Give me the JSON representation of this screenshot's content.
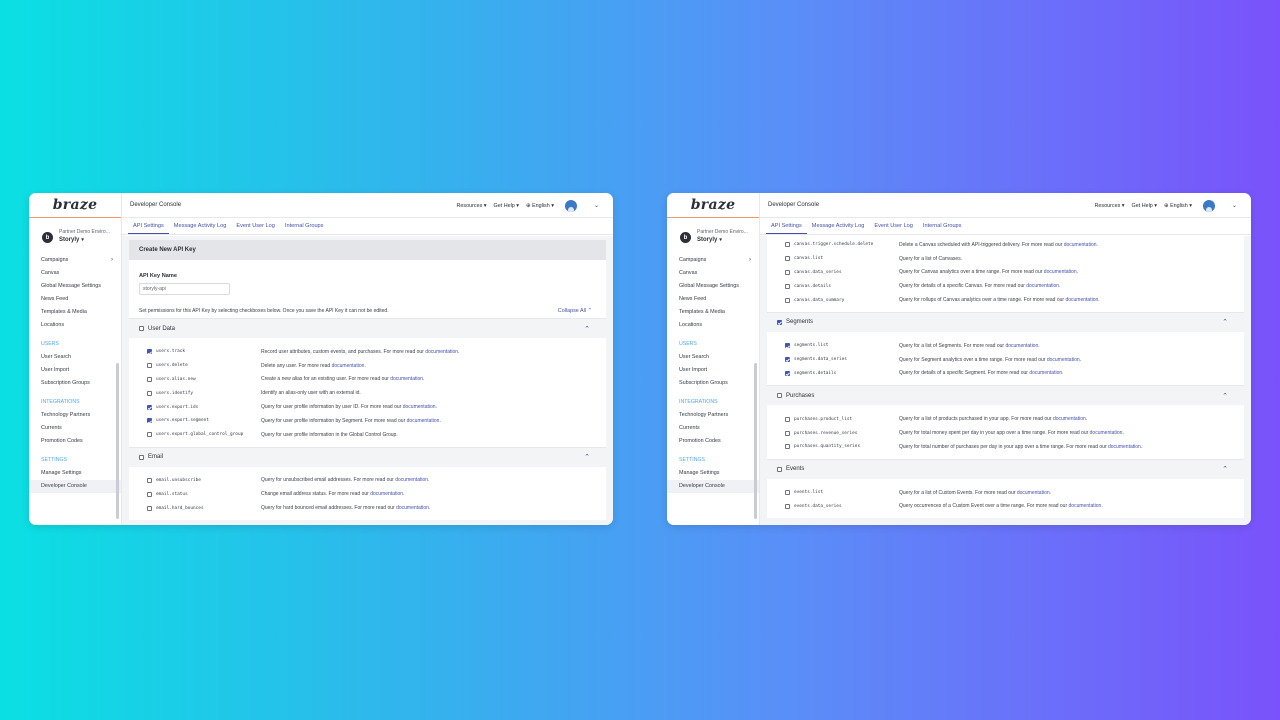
{
  "app": {
    "logo": "braze",
    "workspace_env": "Partner Demo Enviro...",
    "workspace_name": "Storyly",
    "topbar_title": "Developer Console",
    "resources": "Resources",
    "get_help": "Get Help",
    "language": "English"
  },
  "sidebar": {
    "items_top": [
      {
        "label": "Campaigns",
        "arrow": "›"
      },
      {
        "label": "Canvas"
      },
      {
        "label": "Global Message Settings"
      },
      {
        "label": "News Feed"
      },
      {
        "label": "Templates & Media"
      },
      {
        "label": "Locations"
      }
    ],
    "users_head": "USERS",
    "users_items": [
      "User Search",
      "User Import",
      "Subscription Groups"
    ],
    "integrations_head": "INTEGRATIONS",
    "integrations_items": [
      "Technology Partners",
      "Currents",
      "Promotion Codes"
    ],
    "settings_head": "SETTINGS",
    "settings_items": [
      "Manage Settings",
      "Developer Console"
    ]
  },
  "tabs": [
    "API Settings",
    "Message Activity Log",
    "Event User Log",
    "Internal Groups"
  ],
  "left": {
    "card_title": "Create New API Key",
    "key_name_label": "API Key Name",
    "key_name_value": "storyly-api",
    "help_text": "Set permissions for this API Key by selecting checkboxes below. Once you save the API Key it can not be edited.",
    "collapse_all": "Collapse All",
    "sections": [
      {
        "title": "User Data",
        "rows": [
          {
            "name": "users.track",
            "desc": "Record user attributes, custom events, and purchases. For more read our ",
            "checked": true
          },
          {
            "name": "users.delete",
            "desc": "Delete any user. For more read ",
            "checked": false
          },
          {
            "name": "users.alias.new",
            "desc": "Create a new alias for an existing user. For more read our ",
            "checked": false
          },
          {
            "name": "users.identify",
            "desc": "Identify an alias-only user with an external id.",
            "checked": false,
            "nolink": true
          },
          {
            "name": "users.export.ids",
            "desc": "Query for user profile information by user ID. For more read our ",
            "checked": true
          },
          {
            "name": "users.export.segment",
            "desc": "Query for user profile information by Segment. For more read our ",
            "checked": true
          },
          {
            "name": "users.export.global_control_group",
            "desc": "Query for user profile information in the Global Control Group.",
            "checked": false,
            "nolink": true
          }
        ]
      },
      {
        "title": "Email",
        "rows": [
          {
            "name": "email.unsubscribe",
            "desc": "Query for unsubscribed email addresses. For more read our ",
            "checked": false
          },
          {
            "name": "email.status",
            "desc": "Change email address status. For more read our ",
            "checked": false
          },
          {
            "name": "email.hard_bounces",
            "desc": "Query for hard bounced email addresses. For more read our ",
            "checked": false
          }
        ]
      }
    ]
  },
  "right": {
    "canvas_rows": [
      {
        "name": "canvas.trigger.schedule.delete",
        "desc": "Delete a Canvas scheduled with API-triggered delivery. For more read our ",
        "checked": false
      },
      {
        "name": "canvas.list",
        "desc": "Query for a list of Canvases.",
        "checked": false,
        "nolink": true
      },
      {
        "name": "canvas.data_series",
        "desc": "Query for Canvas analytics over a time range. For more read our ",
        "checked": false
      },
      {
        "name": "canvas.details",
        "desc": "Query for details of a specific Canvas. For more read our ",
        "checked": false
      },
      {
        "name": "canvas.data_summary",
        "desc": "Query for rollups of Canvas analytics over a time range. For more read our ",
        "checked": false
      }
    ],
    "sections": [
      {
        "title": "Segments",
        "checked": true,
        "rows": [
          {
            "name": "segments.list",
            "desc": "Query for a list of Segments. For more read our ",
            "checked": true
          },
          {
            "name": "segments.data_series",
            "desc": "Query for Segment analytics over a time range. For more read our ",
            "checked": true
          },
          {
            "name": "segments.details",
            "desc": "Query for details of a specific Segment. For more read our ",
            "checked": true
          }
        ]
      },
      {
        "title": "Purchases",
        "checked": false,
        "rows": [
          {
            "name": "purchases.product_list",
            "desc": "Query for a list of products purchased in your app. For more read our ",
            "checked": false
          },
          {
            "name": "purchases.revenue_series",
            "desc": "Query for total money spent per day in your app over a time range. For more read our ",
            "checked": false
          },
          {
            "name": "purchases.quantity_series",
            "desc": "Query for total number of purchases per day in your app over a time range. For more read our ",
            "checked": false
          }
        ]
      },
      {
        "title": "Events",
        "checked": false,
        "rows": [
          {
            "name": "events.list",
            "desc": "Query for a list of Custom Events. For more read our ",
            "checked": false
          },
          {
            "name": "events.data_series",
            "desc": "Query occurrences of a Custom Event over a time range. For more read our ",
            "checked": false
          }
        ]
      }
    ]
  },
  "link_text": "documentation",
  "icons": {
    "collapse": "chevron-up-icon",
    "globe": "globe-icon",
    "user": "user-avatar-icon"
  },
  "colors": {
    "accent": "#4350a8",
    "checkbox": "#3f56b8",
    "heading_blue": "#4fa8e8"
  }
}
